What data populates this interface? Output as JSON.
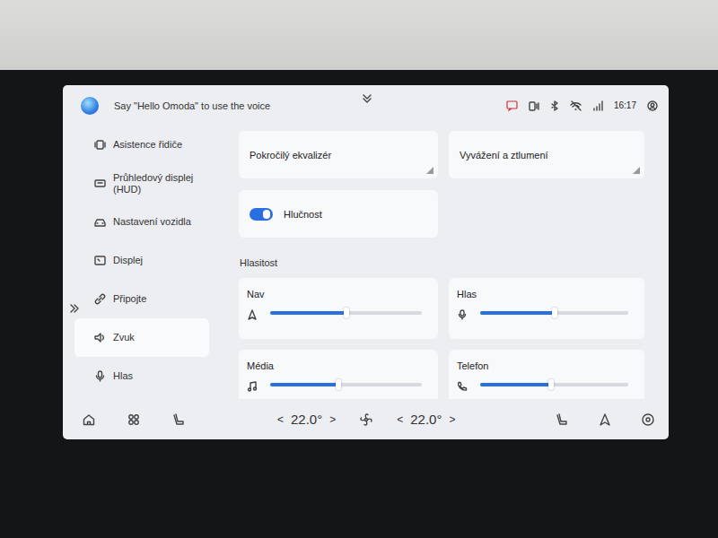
{
  "voice_prompt": "Say \"Hello Omoda\" to use the voice",
  "status_bar": {
    "time": "16:17"
  },
  "sidebar": {
    "items": [
      {
        "label": "Asistence řidiče",
        "selected": false
      },
      {
        "label": "Průhledový displej (HUD)",
        "selected": false
      },
      {
        "label": "Nastavení vozidla",
        "selected": false
      },
      {
        "label": "Displej",
        "selected": false
      },
      {
        "label": "Připojte",
        "selected": false
      },
      {
        "label": "Zvuk",
        "selected": true
      },
      {
        "label": "Hlas",
        "selected": false
      }
    ]
  },
  "cards": [
    {
      "label": "Pokročilý ekvalizér"
    },
    {
      "label": "Vyvážení a ztlumení"
    }
  ],
  "toggle": {
    "label": "Hlučnost",
    "on": true
  },
  "volume": {
    "title": "Hlasitost",
    "sliders": [
      {
        "label": "Nav",
        "level": 0.5
      },
      {
        "label": "Hlas",
        "level": 0.5
      },
      {
        "label": "Média",
        "level": 0.45
      },
      {
        "label": "Telefon",
        "level": 0.48
      }
    ]
  },
  "climate": {
    "left": {
      "dec": "<",
      "temp": "22.0°",
      "inc": ">"
    },
    "right": {
      "dec": "<",
      "temp": "22.0°",
      "inc": ">"
    }
  }
}
